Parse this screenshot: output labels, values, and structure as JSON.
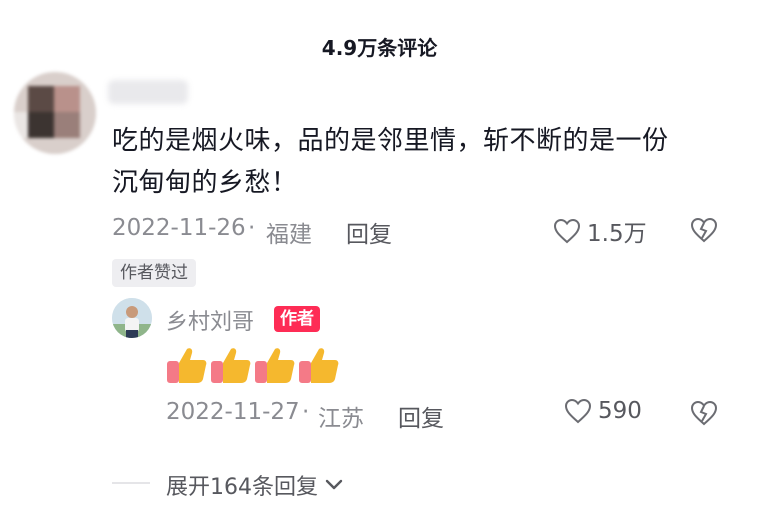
{
  "header": {
    "title": "4.9万条评论"
  },
  "comment": {
    "text_line1": "吃的是烟火味，品的是邻里情，斩不断的是一份",
    "text_line2": "沉甸甸的乡愁！",
    "date": "2022-11-26",
    "dot": "·",
    "location": "福建",
    "reply_label": "回复",
    "like_count": "1.5万",
    "author_liked_badge": "作者赞过"
  },
  "reply": {
    "username": "乡村刘哥",
    "author_tag": "作者",
    "emoji": [
      "thumbs-up",
      "thumbs-up",
      "thumbs-up",
      "thumbs-up"
    ],
    "date": "2022-11-27",
    "dot": "·",
    "location": "江苏",
    "reply_label": "回复",
    "like_count": "590"
  },
  "expand": {
    "label": "展开164条回复"
  },
  "colors": {
    "accent": "#fe2c55",
    "text": "#161823",
    "muted": "#8a8b91",
    "thumb": "#f5b82e",
    "cuff": "#f47a87"
  }
}
